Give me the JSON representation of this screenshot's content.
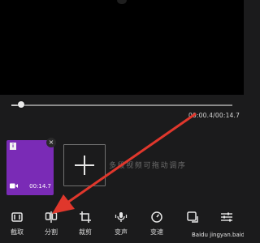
{
  "player": {
    "timecode": "00:00.4/00:14.7",
    "progress": 0.03
  },
  "clips": [
    {
      "duration": "00:14.7",
      "badge": "i",
      "close_glyph": "×",
      "type_icon": "video-camera-icon",
      "color": "#7a2bb6"
    }
  ],
  "add_clip": {
    "icon": "plus-icon",
    "hint": "多段视频可拖动调序"
  },
  "toolbar": {
    "items": [
      {
        "label": "截取",
        "icon": "trim-icon"
      },
      {
        "label": "分割",
        "icon": "split-icon"
      },
      {
        "label": "裁剪",
        "icon": "crop-icon"
      },
      {
        "label": "变声",
        "icon": "voice-change-icon"
      },
      {
        "label": "变速",
        "icon": "speed-icon"
      },
      {
        "label": "",
        "icon": "rotate-icon"
      },
      {
        "label": "",
        "icon": "adjust-sliders-icon"
      }
    ]
  },
  "watermark": "Baidu jingyan.baidu.com",
  "annotation": {
    "color": "#e0372c"
  }
}
